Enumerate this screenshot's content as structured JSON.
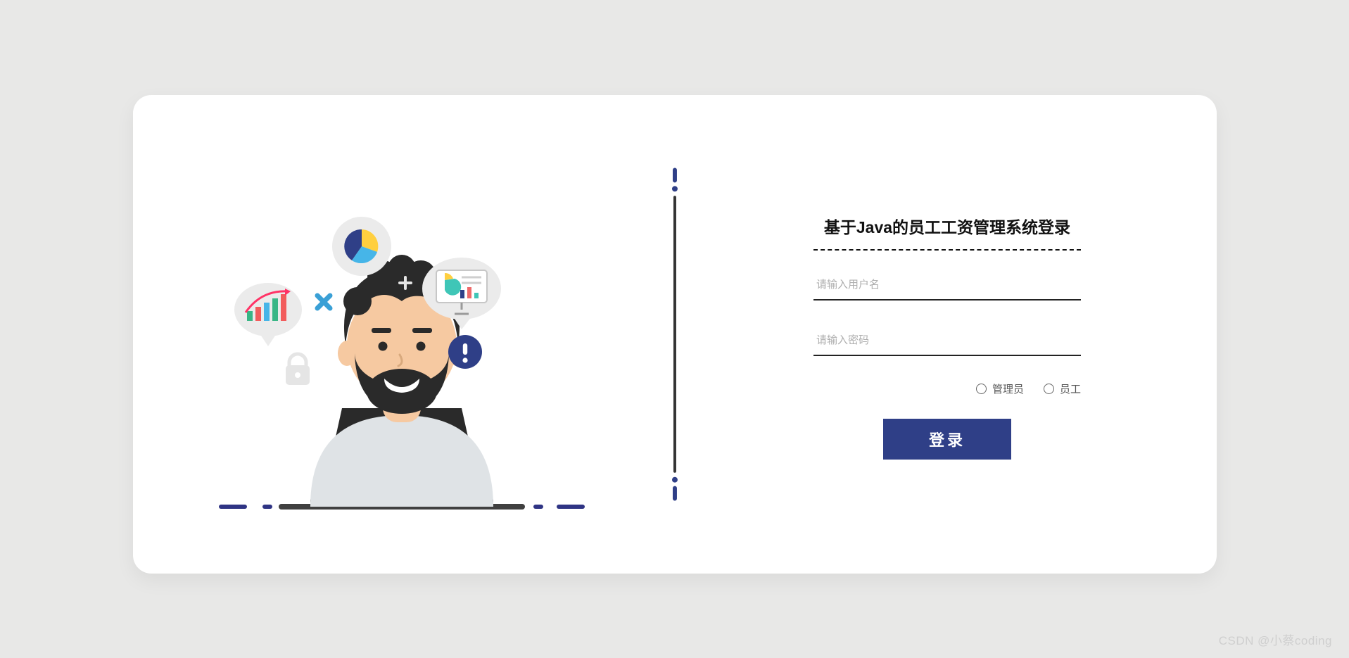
{
  "form": {
    "title": "基于Java的员工工资管理系统登录",
    "username_placeholder": "请输入用户名",
    "password_placeholder": "请输入密码",
    "roles": [
      {
        "label": "管理员"
      },
      {
        "label": "员工"
      }
    ],
    "login_label": "登录"
  },
  "watermark": "CSDN @小蔡coding"
}
